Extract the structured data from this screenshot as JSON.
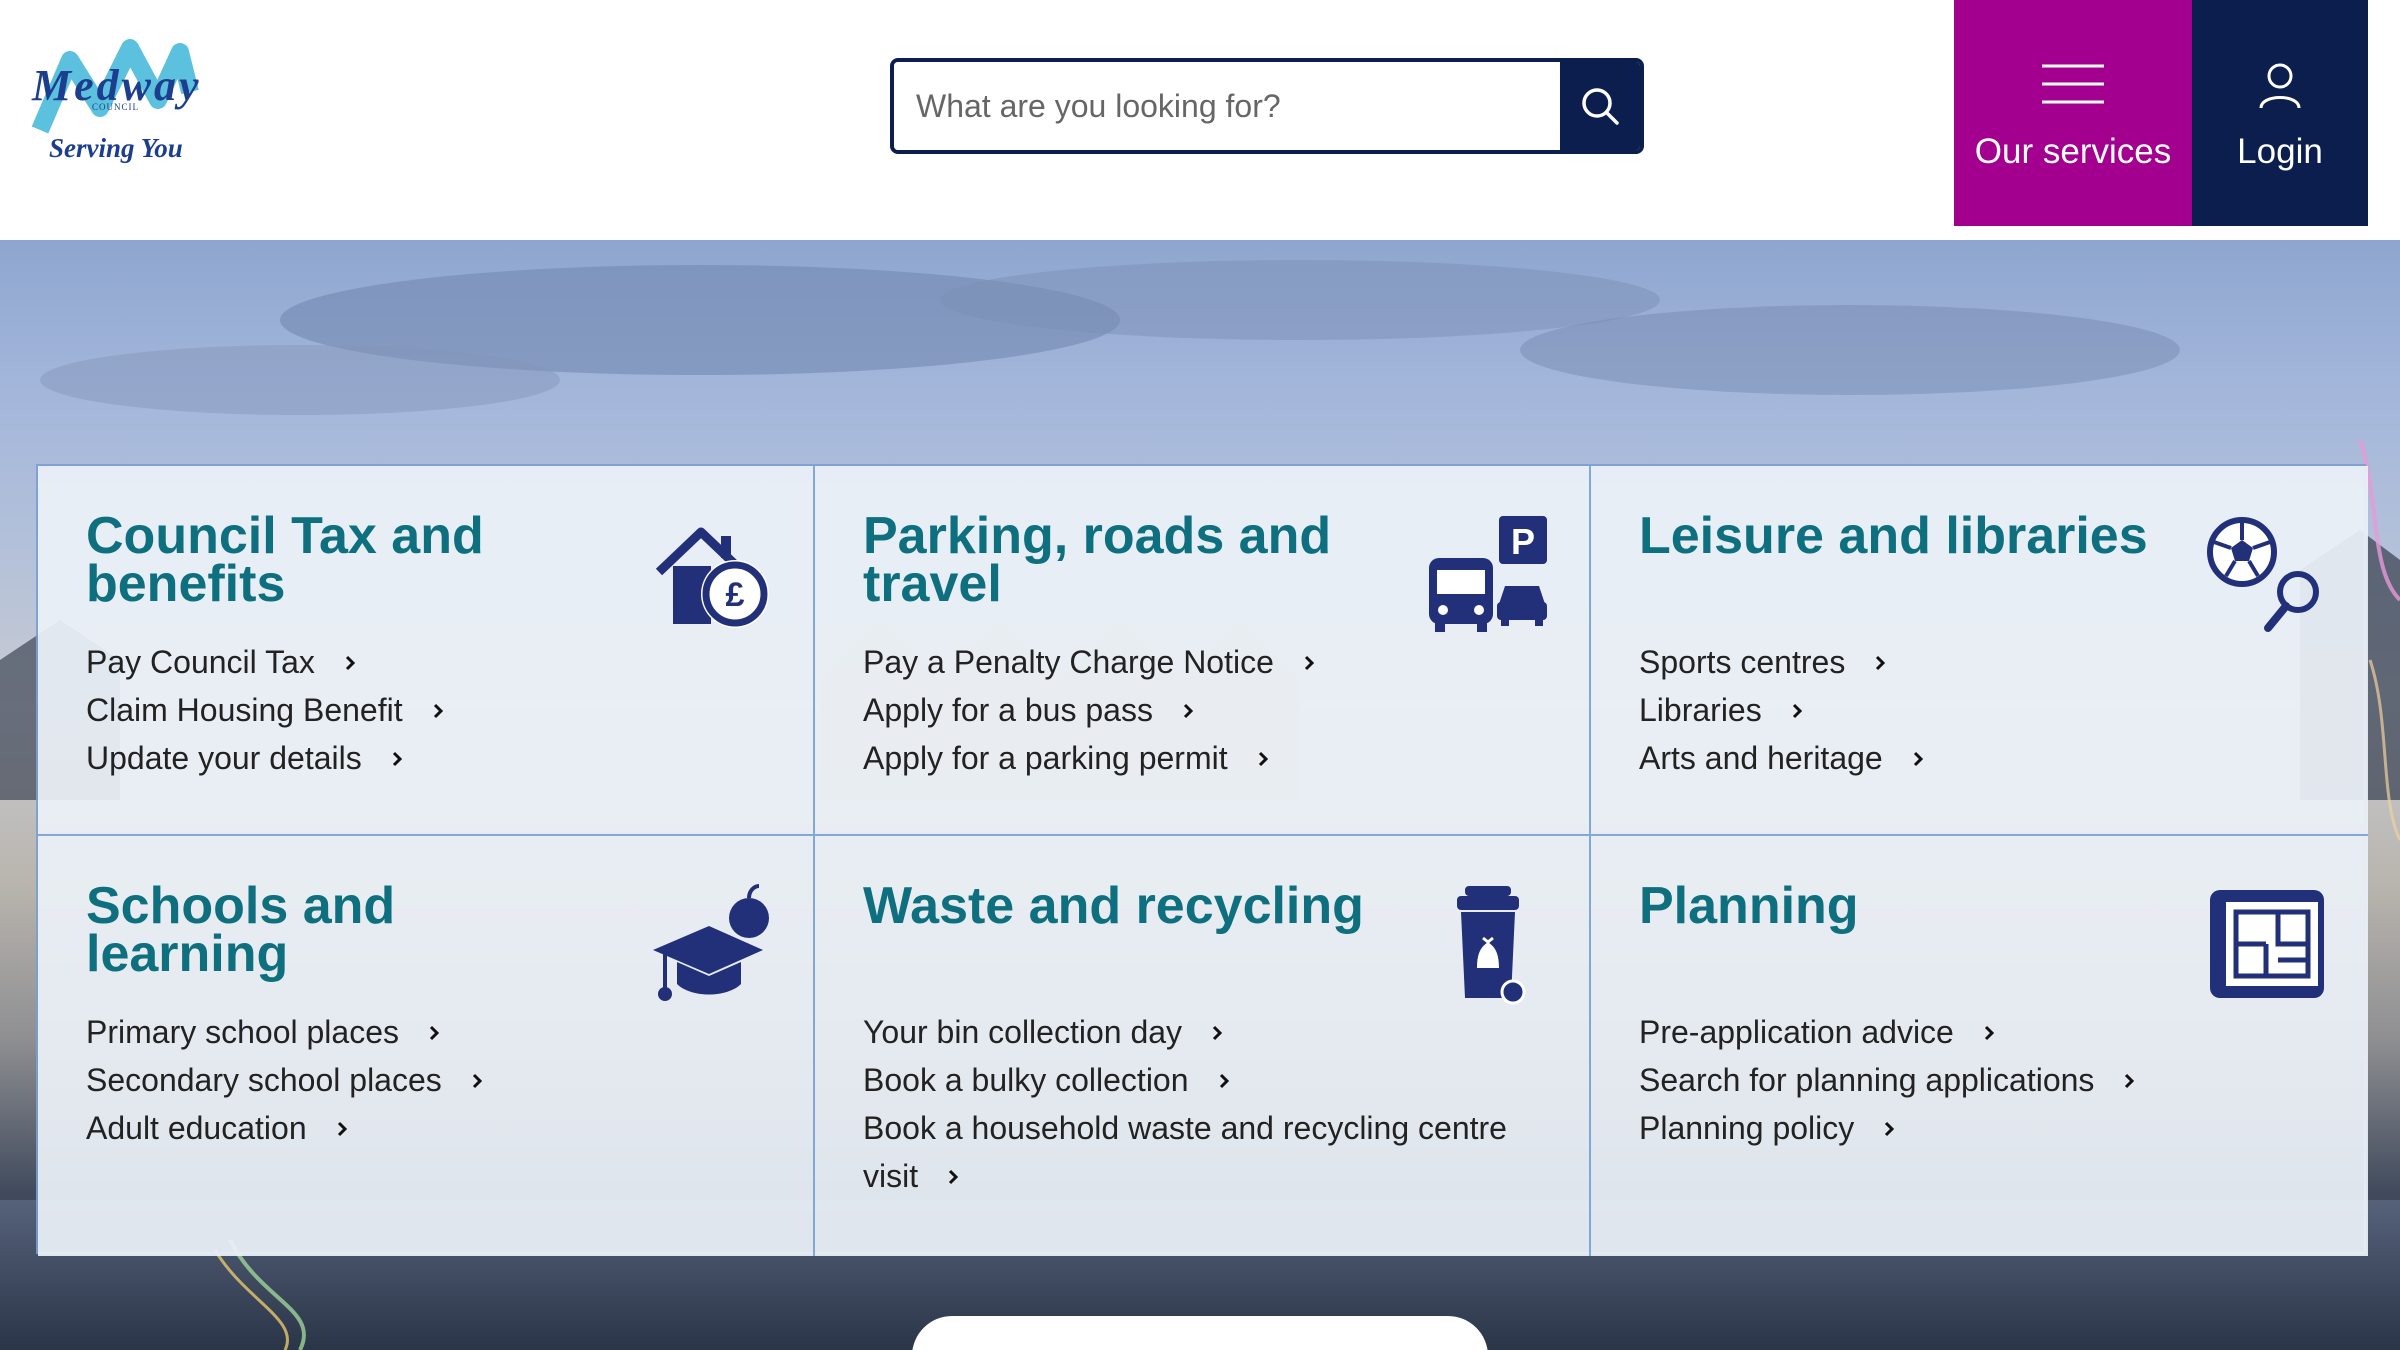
{
  "header": {
    "logo": {
      "name": "Medway",
      "council": "COUNCIL",
      "tagline": "Serving You"
    },
    "search": {
      "placeholder": "What are you looking for?",
      "button_icon": "search-icon"
    },
    "services_button": {
      "label": "Our services",
      "icon": "menu-icon"
    },
    "login_button": {
      "label": "Login",
      "icon": "user-icon"
    }
  },
  "colors": {
    "brand_navy": "#0b1e4e",
    "services_magenta": "#a3008f",
    "title_teal": "#0e6f7f",
    "icon_blue": "#22307a"
  },
  "services": [
    {
      "title": "Council Tax and benefits",
      "icon": "house-pound-icon",
      "links": [
        "Pay Council Tax",
        "Claim Housing Benefit",
        "Update your details"
      ]
    },
    {
      "title": "Parking, roads and travel",
      "icon": "bus-car-parking-icon",
      "links": [
        "Pay a Penalty Charge Notice",
        "Apply for a bus pass",
        "Apply for a parking permit"
      ]
    },
    {
      "title": "Leisure and libraries",
      "icon": "football-magnifier-icon",
      "links": [
        "Sports centres",
        "Libraries",
        "Arts and heritage"
      ]
    },
    {
      "title": "Schools and learning",
      "icon": "mortarboard-apple-icon",
      "links": [
        "Primary school places",
        "Secondary school places",
        "Adult education"
      ]
    },
    {
      "title": "Waste and recycling",
      "icon": "bin-bag-icon",
      "links": [
        "Your bin collection day",
        "Book a bulky collection",
        "Book a household waste and recycling centre visit"
      ]
    },
    {
      "title": "Planning",
      "icon": "floor-plan-icon",
      "links": [
        "Pre-application advice",
        "Search for planning applications",
        "Planning policy"
      ]
    }
  ]
}
